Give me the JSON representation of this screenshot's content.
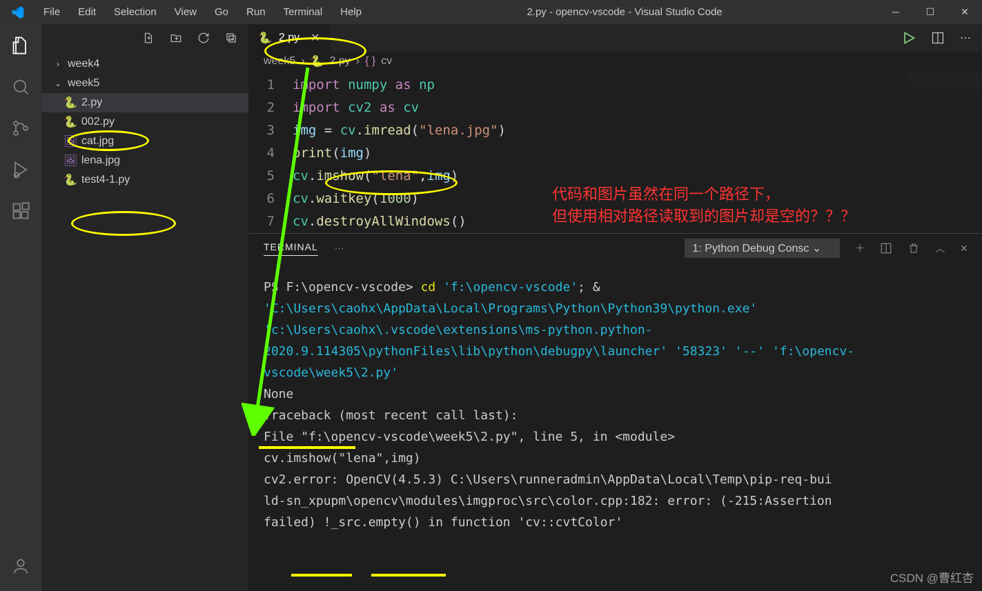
{
  "title": "2.py - opencv-vscode - Visual Studio Code",
  "menu": [
    "File",
    "Edit",
    "Selection",
    "View",
    "Go",
    "Run",
    "Terminal",
    "Help"
  ],
  "sidebar": {
    "folders": [
      {
        "name": "week4",
        "expanded": false
      },
      {
        "name": "week5",
        "expanded": true
      }
    ],
    "files": [
      {
        "name": "2.py",
        "type": "py",
        "selected": true
      },
      {
        "name": "002.py",
        "type": "py"
      },
      {
        "name": "cat.jpg",
        "type": "img"
      },
      {
        "name": "lena.jpg",
        "type": "img"
      },
      {
        "name": "test4-1.py",
        "type": "py"
      }
    ]
  },
  "tab": {
    "label": "2.py"
  },
  "breadcrumbs": {
    "p1": "week5",
    "p2": "2.py",
    "p3": "cv"
  },
  "code_lines": [
    "1",
    "2",
    "3",
    "4",
    "5",
    "6",
    "7"
  ],
  "code": {
    "l1": {
      "a": "import",
      "b": "numpy",
      "c": "as",
      "d": "np"
    },
    "l2": {
      "a": "import",
      "b": "cv2",
      "c": "as",
      "d": "cv"
    },
    "l3": {
      "a": "img",
      "b": "=",
      "c": "cv",
      "d": ".",
      "e": "imread",
      "f": "(",
      "g": "\"lena.jpg\"",
      "h": ")"
    },
    "l4": {
      "a": "print",
      "b": "(",
      "c": "img",
      "d": ")"
    },
    "l5": {
      "a": "cv",
      "b": ".",
      "c": "imshow",
      "d": "(",
      "e": "\"lena\"",
      "f": ",",
      "g": "img",
      "h": ")"
    },
    "l6": {
      "a": "cv",
      "b": ".",
      "c": "waitkey",
      "d": "(",
      "e": "1000",
      "f": ")"
    },
    "l7": {
      "a": "cv",
      "b": ".",
      "c": "destroyAllWindows",
      "d": "()"
    }
  },
  "panel": {
    "tab": "TERMINAL",
    "more": "⋯",
    "select": "1: Python Debug Consc"
  },
  "terminal": {
    "ps": "PS F:\\opencv-vscode> ",
    "cmd1": "cd ",
    "path1": "'f:\\opencv-vscode'",
    "sep": "; & ",
    "path2": "'C:\\Users\\caohx\\AppData\\Local\\Programs\\Python\\Python39\\python.exe'",
    "sp": " ",
    "path3": "'c:\\Users\\caohx\\.vscode\\extensions\\ms-python.python-2020.9.114305\\pythonFiles\\lib\\python\\debugpy\\launcher'",
    "path4": "'58323'",
    "path5": "'--'",
    "path6": "'f:\\opencv-vscode\\week5\\2.py'",
    "none": "None",
    "tb": "Traceback (most recent call last):",
    "file": "  File \"f:\\opencv-vscode\\week5\\2.py\", line 5, in <module>",
    "call": "    cv.imshow(\"lena\",img)",
    "err1": "cv2.error: OpenCV(4.5.3) C:\\Users\\runneradmin\\AppData\\Local\\Temp\\pip-req-bui",
    "err2": "ld-sn_xpupm\\opencv\\modules\\imgproc\\src\\color.cpp:182: error: (-215:Assertion",
    "err3": " failed) !_src.empty() in function 'cv::cvtColor'"
  },
  "annotation": {
    "line1": "代码和图片虽然在同一个路径下，",
    "line2": "但使用相对路径读取到的图片却是空的？？？"
  },
  "watermark": "CSDN @曹红杏"
}
